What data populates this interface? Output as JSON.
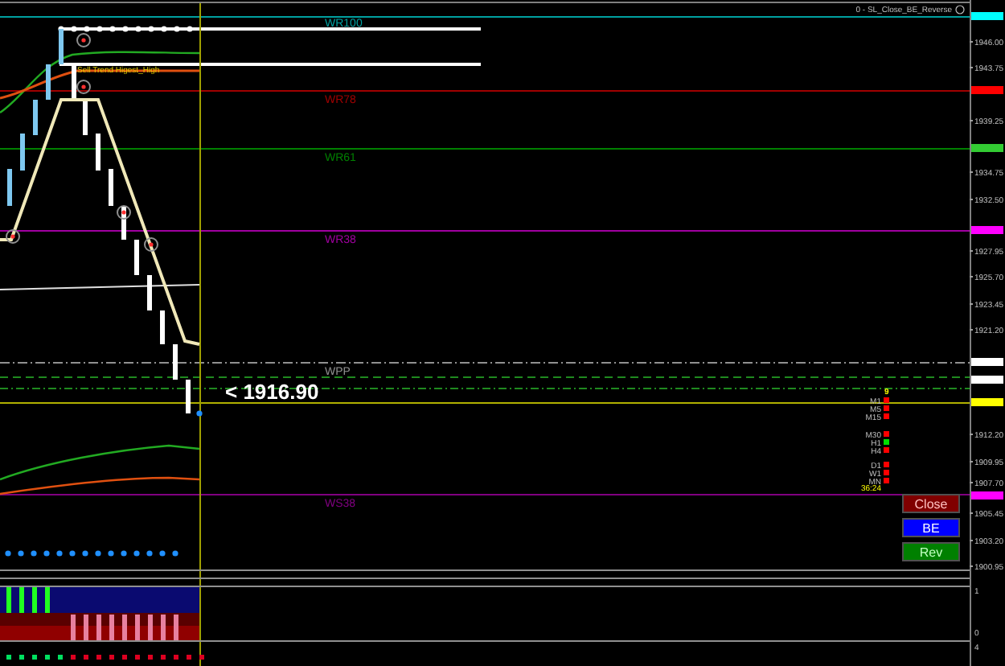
{
  "chart": {
    "title": "0 - SL_Close_BE_Reverse",
    "levels": [
      {
        "label": "WR100",
        "color": "#00a0a0",
        "kind": "solid"
      },
      {
        "label": "WR78",
        "color": "#a00000",
        "kind": "solid"
      },
      {
        "label": "WR61",
        "color": "#008000",
        "kind": "solid"
      },
      {
        "label": "WR38",
        "color": "#a000a0",
        "kind": "solid"
      },
      {
        "label": "WPP",
        "color": "#909090",
        "kind": "dashdot"
      },
      {
        "label": "WS38",
        "color": "#800080",
        "kind": "solid"
      }
    ],
    "signal_label": "Sell Trend Higest_High",
    "price_label": "< 1916.90",
    "price_axis": [
      "1946.00",
      "1943.75",
      "1939.25",
      "1934.75",
      "1932.50",
      "1927.95",
      "1925.70",
      "1923.45",
      "1921.20",
      "1912.20",
      "1909.95",
      "1907.70",
      "1905.45",
      "1903.20",
      "1900.95"
    ],
    "price_tags": [
      {
        "color": "#00ffff"
      },
      {
        "color": "#ff0000"
      },
      {
        "color": "#33cc33"
      },
      {
        "color": "#ff00ff"
      },
      {
        "color": "#ffffff"
      },
      {
        "color": "#ffffff"
      },
      {
        "color": "#ffff00"
      },
      {
        "color": "#ff00ff"
      }
    ]
  },
  "timeframes": {
    "counter": "9",
    "groups": [
      [
        {
          "label": "M1",
          "color": "#ff0000"
        },
        {
          "label": "M5",
          "color": "#ff0000"
        },
        {
          "label": "M15",
          "color": "#ff0000"
        }
      ],
      [
        {
          "label": "M30",
          "color": "#ff0000"
        },
        {
          "label": "H1",
          "color": "#00dd00"
        },
        {
          "label": "H4",
          "color": "#ff0000"
        }
      ],
      [
        {
          "label": "D1",
          "color": "#ff0000"
        },
        {
          "label": "W1",
          "color": "#ff0000"
        },
        {
          "label": "MN",
          "color": "#ff0000"
        }
      ]
    ],
    "timer": "36:24"
  },
  "buttons": [
    {
      "label": "Close",
      "kind": "close"
    },
    {
      "label": "BE",
      "kind": "breakeven"
    },
    {
      "label": "Rev",
      "kind": "reverse"
    }
  ],
  "indicator_axis": [
    "1",
    "0",
    "4"
  ]
}
